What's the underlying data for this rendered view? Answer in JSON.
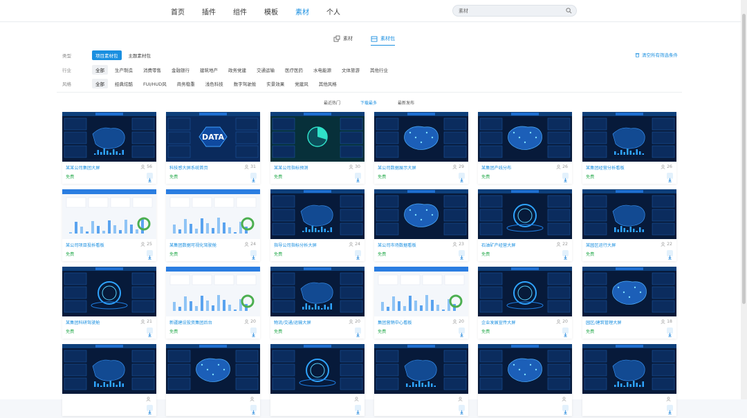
{
  "nav": {
    "items": [
      "首页",
      "插件",
      "组件",
      "模板",
      "素材",
      "个人"
    ],
    "active": "素材"
  },
  "search": {
    "value": "素材",
    "placeholder": ""
  },
  "subtabs": [
    "素材",
    "素材包"
  ],
  "subtab_active": "素材包",
  "filters": {
    "type": {
      "label": "类型",
      "options": [
        "项目素材包",
        "主题素材包"
      ]
    },
    "industry": {
      "label": "行业",
      "options": [
        "全部",
        "生产制造",
        "消费零售",
        "金融银行",
        "建筑地产",
        "政务党建",
        "交通运输",
        "医疗医药",
        "水电能源",
        "文体旅游",
        "其他行业"
      ]
    },
    "style": {
      "label": "风格",
      "options": [
        "全部",
        "经典炫酷",
        "FUI/HUD风",
        "商务稳重",
        "浅色科技",
        "数字驾驶舱",
        "实景效果",
        "党建风",
        "其他风格"
      ]
    }
  },
  "clear_filter": "清空所有筛选条件",
  "sort": {
    "options": [
      "最近热门",
      "下载最多",
      "最新发布"
    ],
    "active": "下载最多"
  },
  "accent_color": "#1a8fe0",
  "free_color": "#36b05a",
  "cards": [
    {
      "title": "某某公司集团大屏",
      "count": "56",
      "price": "免费",
      "theme": "dark"
    },
    {
      "title": "科技感大屏系统首页",
      "count": "31",
      "price": "免费",
      "theme": "data"
    },
    {
      "title": "某某公司指标预测",
      "count": "30",
      "price": "免费",
      "theme": "teal"
    },
    {
      "title": "某公司数据展示大屏",
      "count": "29",
      "price": "免费",
      "theme": "map"
    },
    {
      "title": "某集团产线分布",
      "count": "26",
      "price": "免费",
      "theme": "map"
    },
    {
      "title": "某集团经营分析看板",
      "count": "26",
      "price": "免费",
      "theme": "dark"
    },
    {
      "title": "某公司项目投析看板",
      "count": "25",
      "price": "免费",
      "theme": "light"
    },
    {
      "title": "某集团数据可视化驾驶舱",
      "count": "24",
      "price": "免费",
      "theme": "light"
    },
    {
      "title": "指导公司指标分析大屏",
      "count": "24",
      "price": "免费",
      "theme": "dark"
    },
    {
      "title": "某公司市场数据看板",
      "count": "23",
      "price": "免费",
      "theme": "map"
    },
    {
      "title": "石油矿产经营大屏",
      "count": "22",
      "price": "免费",
      "theme": "ring"
    },
    {
      "title": "某园区运行大屏",
      "count": "22",
      "price": "免费",
      "theme": "dark"
    },
    {
      "title": "某集团科研驾驶舱",
      "count": "21",
      "price": "免费",
      "theme": "ring"
    },
    {
      "title": "新疆建设投资集团后台",
      "count": "20",
      "price": "免费",
      "theme": "light"
    },
    {
      "title": "物流/交通/运输大屏",
      "count": "20",
      "price": "免费",
      "theme": "dark"
    },
    {
      "title": "集团营销中心看板",
      "count": "20",
      "price": "免费",
      "theme": "light"
    },
    {
      "title": "企业发展宣传大屏",
      "count": "20",
      "price": "免费",
      "theme": "ring"
    },
    {
      "title": "园区/建筑管理大屏",
      "count": "18",
      "price": "免费",
      "theme": "map"
    },
    {
      "title": "",
      "count": "",
      "price": "",
      "theme": "dark"
    },
    {
      "title": "",
      "count": "",
      "price": "",
      "theme": "map"
    },
    {
      "title": "",
      "count": "",
      "price": "",
      "theme": "ring"
    },
    {
      "title": "",
      "count": "",
      "price": "",
      "theme": "dark"
    },
    {
      "title": "",
      "count": "",
      "price": "",
      "theme": "map"
    },
    {
      "title": "",
      "count": "",
      "price": "",
      "theme": "dark"
    }
  ],
  "data_word": "DATA"
}
